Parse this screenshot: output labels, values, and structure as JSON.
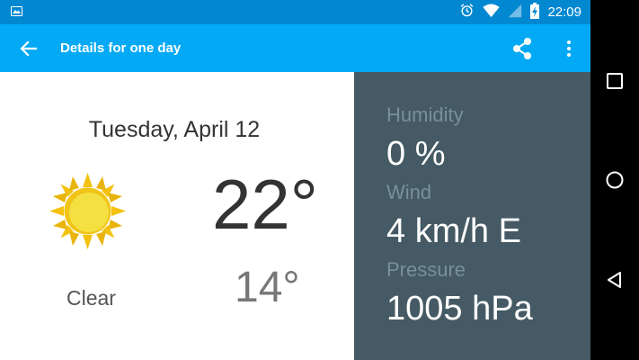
{
  "status_bar": {
    "time": "22:09",
    "icons": [
      "image-icon",
      "alarm-icon",
      "wifi-icon",
      "signal-icon",
      "battery-charging-icon"
    ]
  },
  "app_bar": {
    "title": "Details for one day",
    "icons": [
      "back-arrow-icon",
      "share-icon",
      "more-vert-icon"
    ]
  },
  "detail": {
    "date": "Tuesday, April 12",
    "condition": "Clear",
    "condition_icon": "sun-icon",
    "high": "22°",
    "low": "14°"
  },
  "stats": {
    "humidity_label": "Humidity",
    "humidity_value": "0 %",
    "wind_label": "Wind",
    "wind_value": "4 km/h E",
    "pressure_label": "Pressure",
    "pressure_value": "1005 hPa"
  },
  "colors": {
    "status_bar": "#0288d1",
    "app_bar": "#03a9f4",
    "stats_panel": "#455a64",
    "stats_label": "#78909c"
  },
  "nav_bar": {
    "icons": [
      "recents-icon",
      "home-icon",
      "back-icon"
    ]
  }
}
